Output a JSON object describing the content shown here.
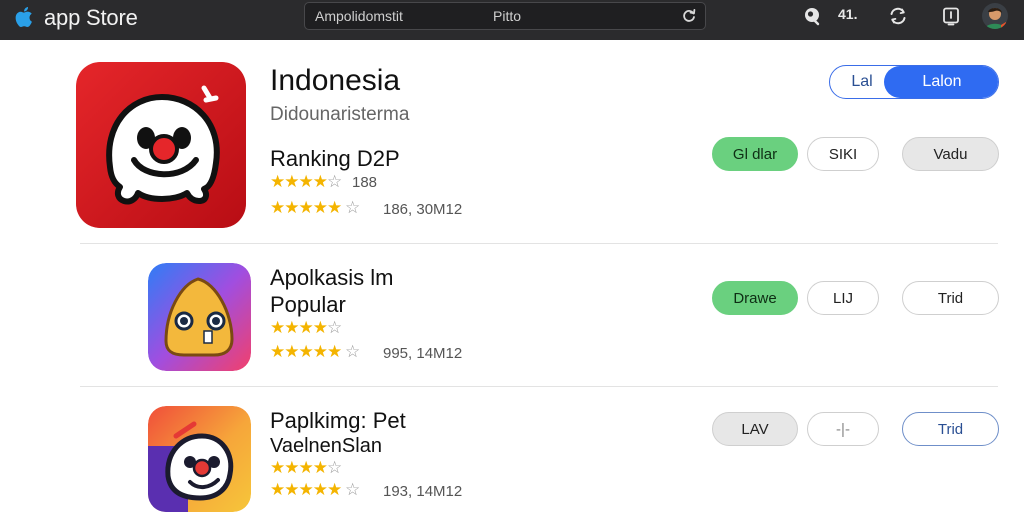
{
  "topbar": {
    "brand": "app Store",
    "search_text": "Ampolidomstit",
    "search_mid": "Pitto",
    "count": "41."
  },
  "apps": [
    {
      "title": "Indonesia",
      "subtitle": "Didounaristerma",
      "line": "Ranking D2P",
      "rating_count_top": "188",
      "rating_count_bottom": "186, 30M12",
      "buttons": [
        "Gl dlar",
        "SIKI",
        "Vadu"
      ]
    },
    {
      "title": "Apolkasis lm",
      "line": "Popular",
      "rating_count_bottom": "995, 14M12",
      "buttons": [
        "Drawe",
        "LIJ",
        "Trid"
      ]
    },
    {
      "title": "Paplkimg: Pet",
      "subtitle": "VaelnenSlan",
      "rating_count_bottom": "193, 14M12",
      "buttons": [
        "LAV",
        "-|-",
        "Trid"
      ]
    }
  ],
  "segment": {
    "left": "Lal",
    "right": "Lalon"
  },
  "colors": {
    "accent": "#2f6bf2",
    "green": "#6ad07f",
    "star": "#f4b400",
    "topbar": "#2b2b2d"
  },
  "icons": [
    "apple-logo-icon",
    "reload-icon",
    "account-icon",
    "sync-icon",
    "bookmark-icon",
    "avatar"
  ]
}
